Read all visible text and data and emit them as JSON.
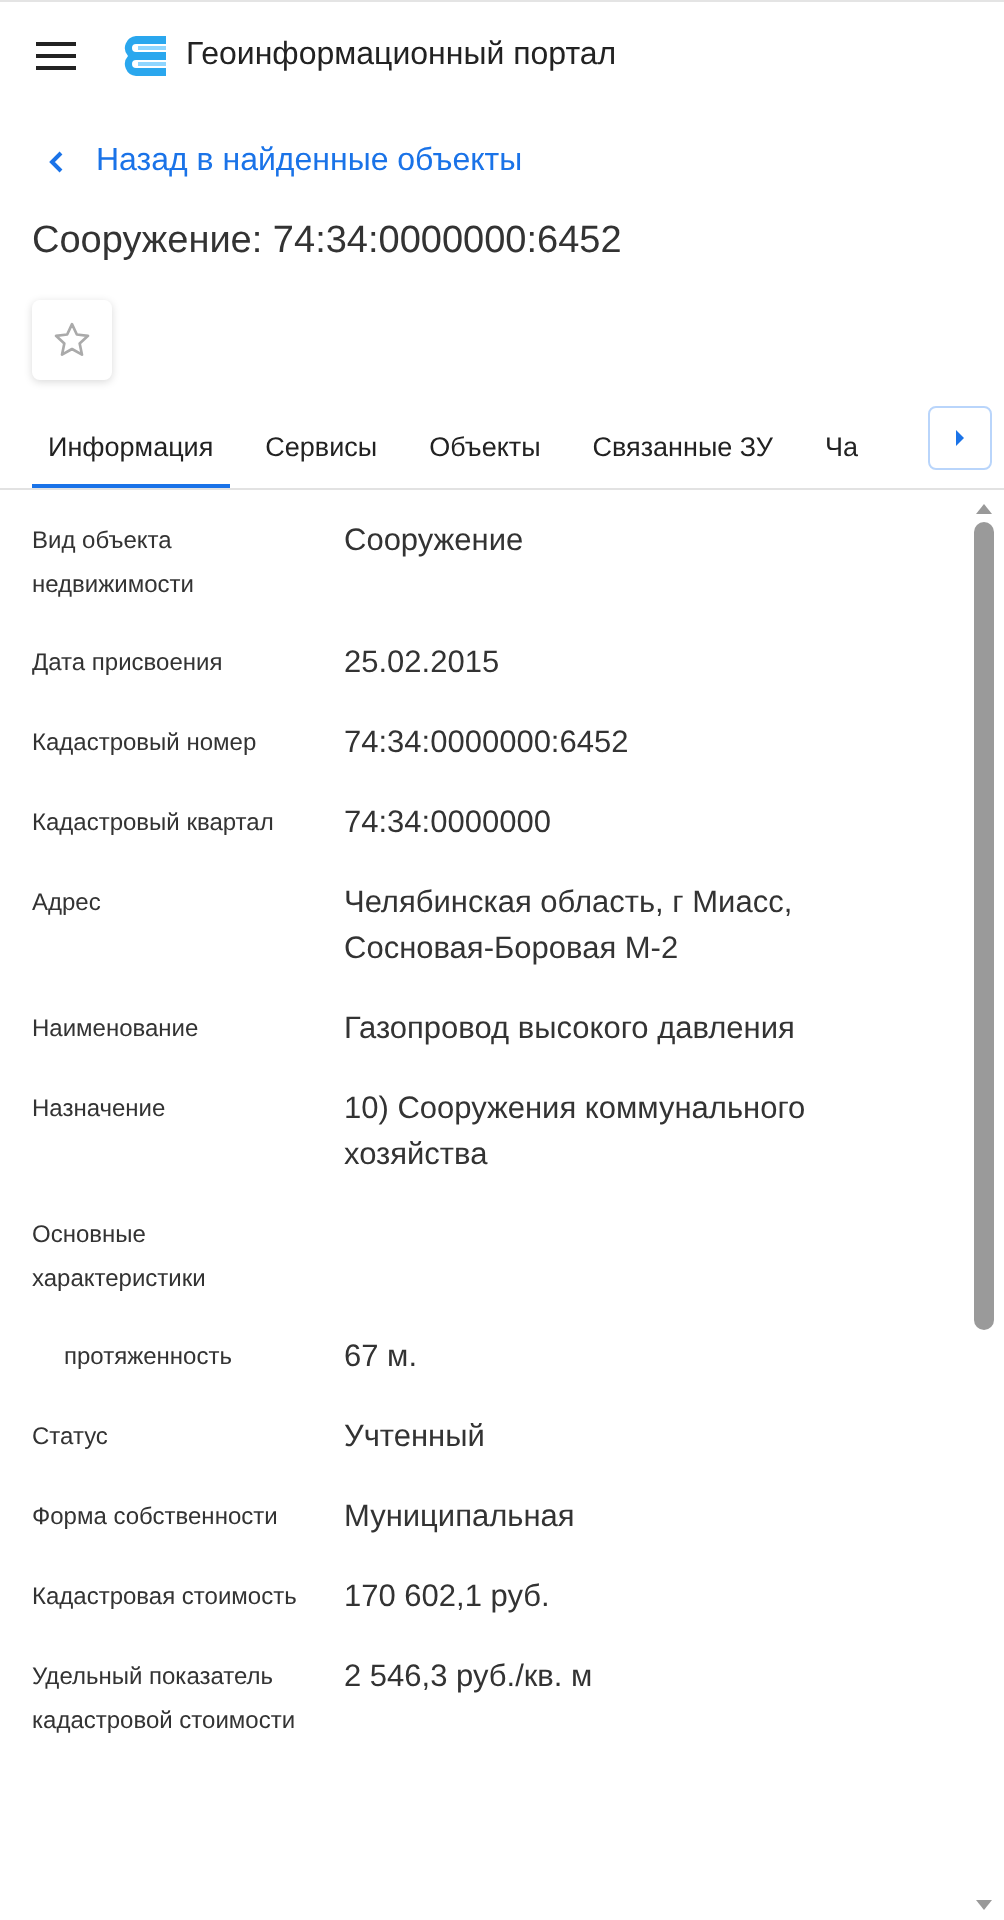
{
  "header": {
    "title": "Геоинформационный портал"
  },
  "back_link": "Назад в найденные объекты",
  "title": "Сооружение: 74:34:0000000:6452",
  "favorite": {
    "on": false
  },
  "tabs": [
    {
      "label": "Информация",
      "selected": true
    },
    {
      "label": "Сервисы",
      "selected": false
    },
    {
      "label": "Объекты",
      "selected": false
    },
    {
      "label": "Связанные ЗУ",
      "selected": false
    },
    {
      "label": "Ча",
      "selected": false
    }
  ],
  "fields": [
    {
      "kind": "main",
      "label": "Вид объекта недвижимости",
      "value": "Сооружение"
    },
    {
      "kind": "main",
      "label": "Дата присвоения",
      "value": "25.02.2015"
    },
    {
      "kind": "main",
      "label": "Кадастровый номер",
      "value": "74:34:0000000:6452"
    },
    {
      "kind": "main",
      "label": "Кадастровый квартал",
      "value": "74:34:0000000"
    },
    {
      "kind": "main",
      "label": "Адрес",
      "value": "Челябинская область, г Миасс, Сосновая-Боровая М-2"
    },
    {
      "kind": "main",
      "label": "Наименование",
      "value": "Газопровод высокого давления"
    },
    {
      "kind": "main",
      "label": "Назначение",
      "value": "10) Сооружения коммунального хозяйства"
    },
    {
      "kind": "main",
      "label": "Основные характеристики"
    },
    {
      "kind": "sub",
      "label": "протяженность",
      "value": "67 м."
    },
    {
      "kind": "main",
      "label": "Статус",
      "value": "Учтенный"
    },
    {
      "kind": "main",
      "label": "Форма собственности",
      "value": "Муниципальная"
    },
    {
      "kind": "main",
      "label": "Кадастровая стоимость",
      "value": "170 602,1 руб."
    },
    {
      "kind": "main",
      "label": "Удельный показатель кадастровой стоимости",
      "value": "2 546,3 руб./кв. м"
    }
  ]
}
